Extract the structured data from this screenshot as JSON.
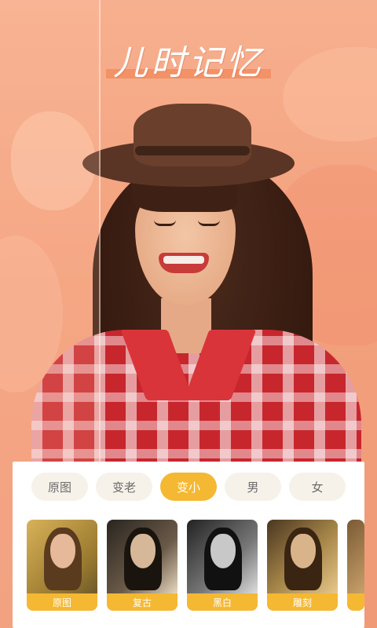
{
  "header": {
    "title": "儿时记忆"
  },
  "tabs": [
    {
      "label": "原图",
      "active": false
    },
    {
      "label": "变老",
      "active": false
    },
    {
      "label": "变小",
      "active": true
    },
    {
      "label": "男",
      "active": false
    },
    {
      "label": "女",
      "active": false
    }
  ],
  "filters": [
    {
      "label": "原图",
      "icon": "photo-thumbnail"
    },
    {
      "label": "复古",
      "icon": "photo-thumbnail"
    },
    {
      "label": "黑白",
      "icon": "photo-thumbnail"
    },
    {
      "label": "雕刻",
      "icon": "photo-thumbnail"
    }
  ],
  "colors": {
    "accent": "#f5b832",
    "background": "#f3a07c",
    "tab_inactive_bg": "#f6f2ea",
    "shirt_red": "#c8262d"
  }
}
